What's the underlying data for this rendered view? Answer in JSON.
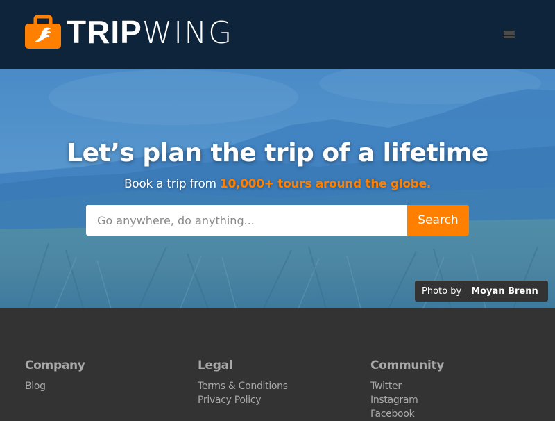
{
  "header": {
    "logo_bold": "TRIP",
    "logo_thin": "WING",
    "menu_icon": "hamburger-menu-icon"
  },
  "hero": {
    "title": "Let’s plan the trip of a lifetime",
    "subtitle_prefix": "Book a trip from ",
    "subtitle_accent": "10,000+ tours around the globe.",
    "search": {
      "placeholder": "Go anywhere, do anything...",
      "value": "",
      "button_label": "Search"
    },
    "credit": {
      "label": "Photo by",
      "author": "Moyan Brenn"
    }
  },
  "footer": {
    "columns": [
      {
        "title": "Company",
        "links": [
          "Blog"
        ]
      },
      {
        "title": "Legal",
        "links": [
          "Terms & Conditions",
          "Privacy Policy"
        ]
      },
      {
        "title": "Community",
        "links": [
          "Twitter",
          "Instagram",
          "Facebook"
        ]
      }
    ]
  },
  "colors": {
    "header_bg": "#0e243a",
    "accent": "#ff8000",
    "footer_bg": "#333333",
    "footer_text": "#a8a8a8"
  }
}
